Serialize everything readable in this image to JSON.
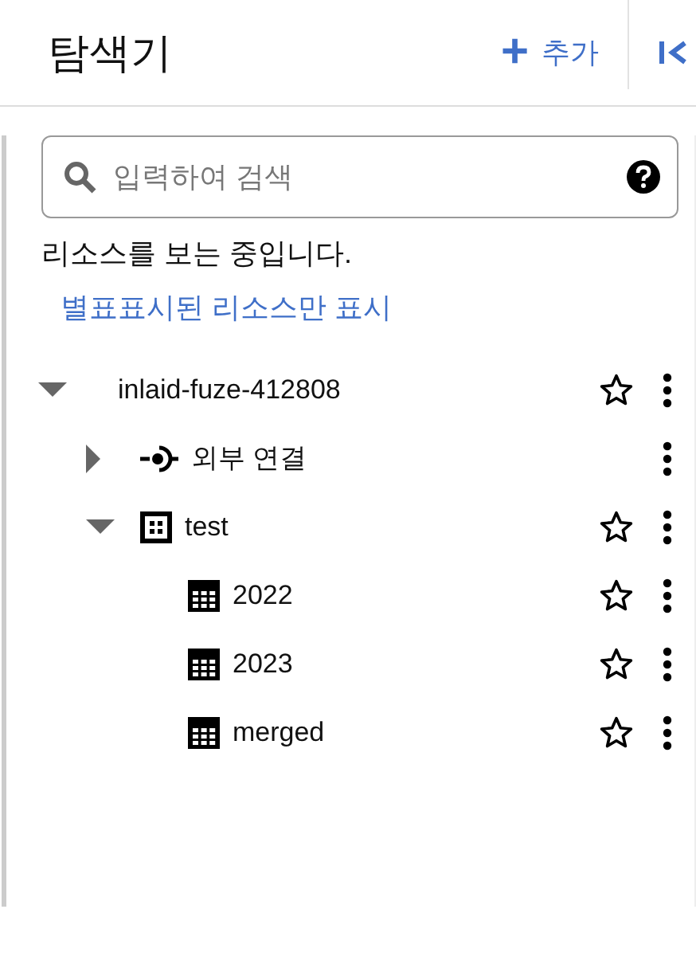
{
  "header": {
    "title": "탐색기",
    "add_button": {
      "icon": "+",
      "label": "추가"
    }
  },
  "search": {
    "placeholder": "입력하여 검색"
  },
  "status_text": "리소스를 보는 중입니다.",
  "starred_filter_link": "별표표시된 리소스만 표시",
  "tree": [
    {
      "kind": "project",
      "label": "inlaid-fuze-412808",
      "expanded": true,
      "starred": false,
      "children": [
        {
          "kind": "connection",
          "label": "외부 연결",
          "expanded": false
        },
        {
          "kind": "dataset",
          "label": "test",
          "expanded": true,
          "starred": false,
          "children": [
            {
              "kind": "table",
              "label": "2022",
              "starred": false
            },
            {
              "kind": "table",
              "label": "2023",
              "starred": false
            },
            {
              "kind": "table",
              "label": "merged",
              "starred": false
            }
          ]
        }
      ]
    }
  ]
}
